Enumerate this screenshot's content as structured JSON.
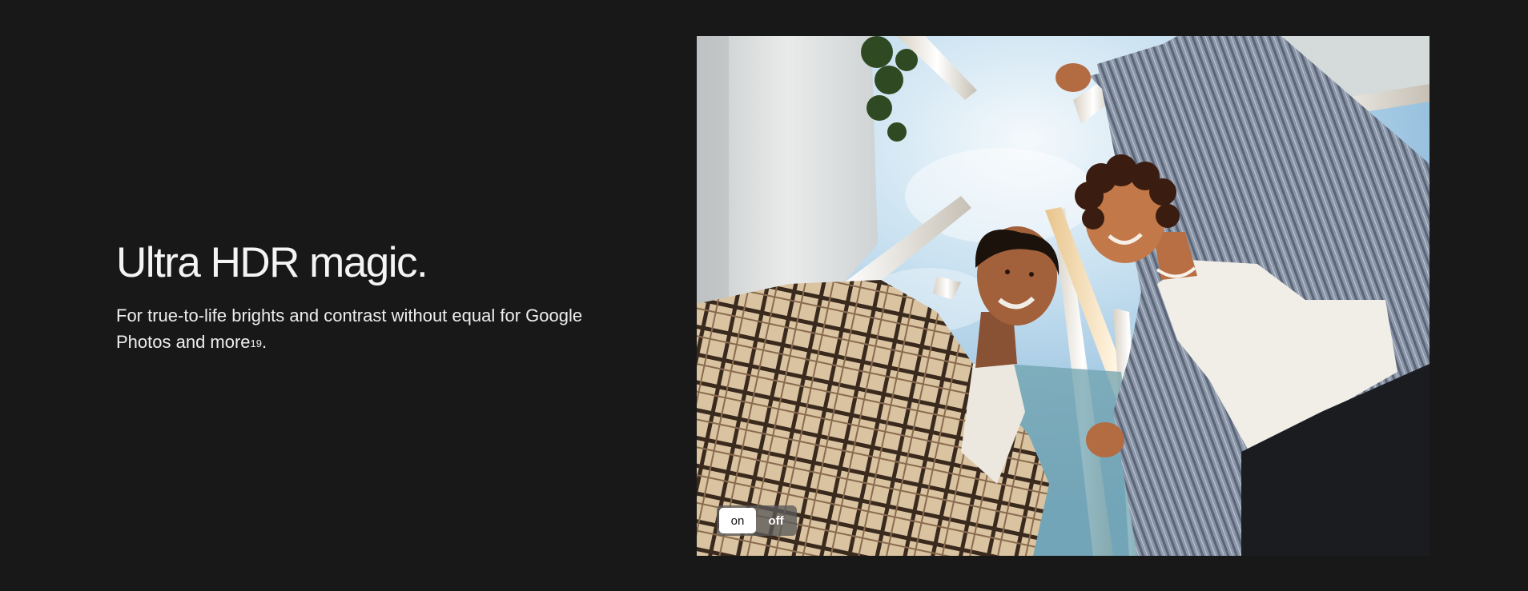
{
  "section": {
    "headline": "Ultra HDR magic.",
    "body_text": "For true-to-life brights and contrast without equal for Google Photos and more",
    "footnote": "19",
    "body_end": "."
  },
  "photo": {
    "icon": "photo-of-two-men-hdr"
  },
  "hdr_toggle": {
    "on_label": "on",
    "off_label": "off",
    "selected": "on"
  },
  "colors": {
    "background": "#181818",
    "text": "#f4f4f4",
    "toggle_active_bg": "#ffffff"
  }
}
